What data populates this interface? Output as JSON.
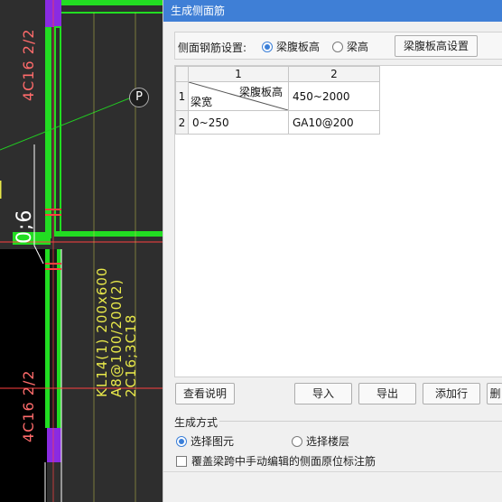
{
  "cad": {
    "label_top": "4C16 2/2",
    "label_bottom": "4C16 2/2",
    "dimension": "0;6",
    "beam_line1": "KL14(1) 200x600",
    "beam_line2": "A8@100/200(2)",
    "beam_line3": "2C16;3C18",
    "marker": "P",
    "colors": {
      "column_green": "#22dd22",
      "beam_red": "#ff4040",
      "purple": "#8a2be2",
      "yellow": "#e8e84a"
    }
  },
  "dialog": {
    "title": "生成侧面筋",
    "setting_label": "侧面钢筋设置:",
    "radio_options": [
      {
        "label": "梁腹板高",
        "selected": true
      },
      {
        "label": "梁高",
        "selected": false
      }
    ],
    "height_setting_button": "梁腹板高设置",
    "grid": {
      "col_headers": [
        "1",
        "2"
      ],
      "row_headers": [
        "1",
        "2"
      ],
      "diag_top": "梁腹板高",
      "diag_bottom": "梁宽",
      "r1c2": "450~2000",
      "r2c1": "0~250",
      "r2c2": "GA10@200"
    },
    "buttons": {
      "help": "查看说明",
      "import": "导入",
      "export": "导出",
      "add_row": "添加行",
      "partial": "删"
    },
    "gen_mode_title": "生成方式",
    "gen_options": [
      {
        "label": "选择图元",
        "selected": true
      },
      {
        "label": "选择楼层",
        "selected": false
      }
    ],
    "override_checkbox": {
      "label": "覆盖梁跨中手动编辑的侧面原位标注筋",
      "checked": false
    }
  }
}
